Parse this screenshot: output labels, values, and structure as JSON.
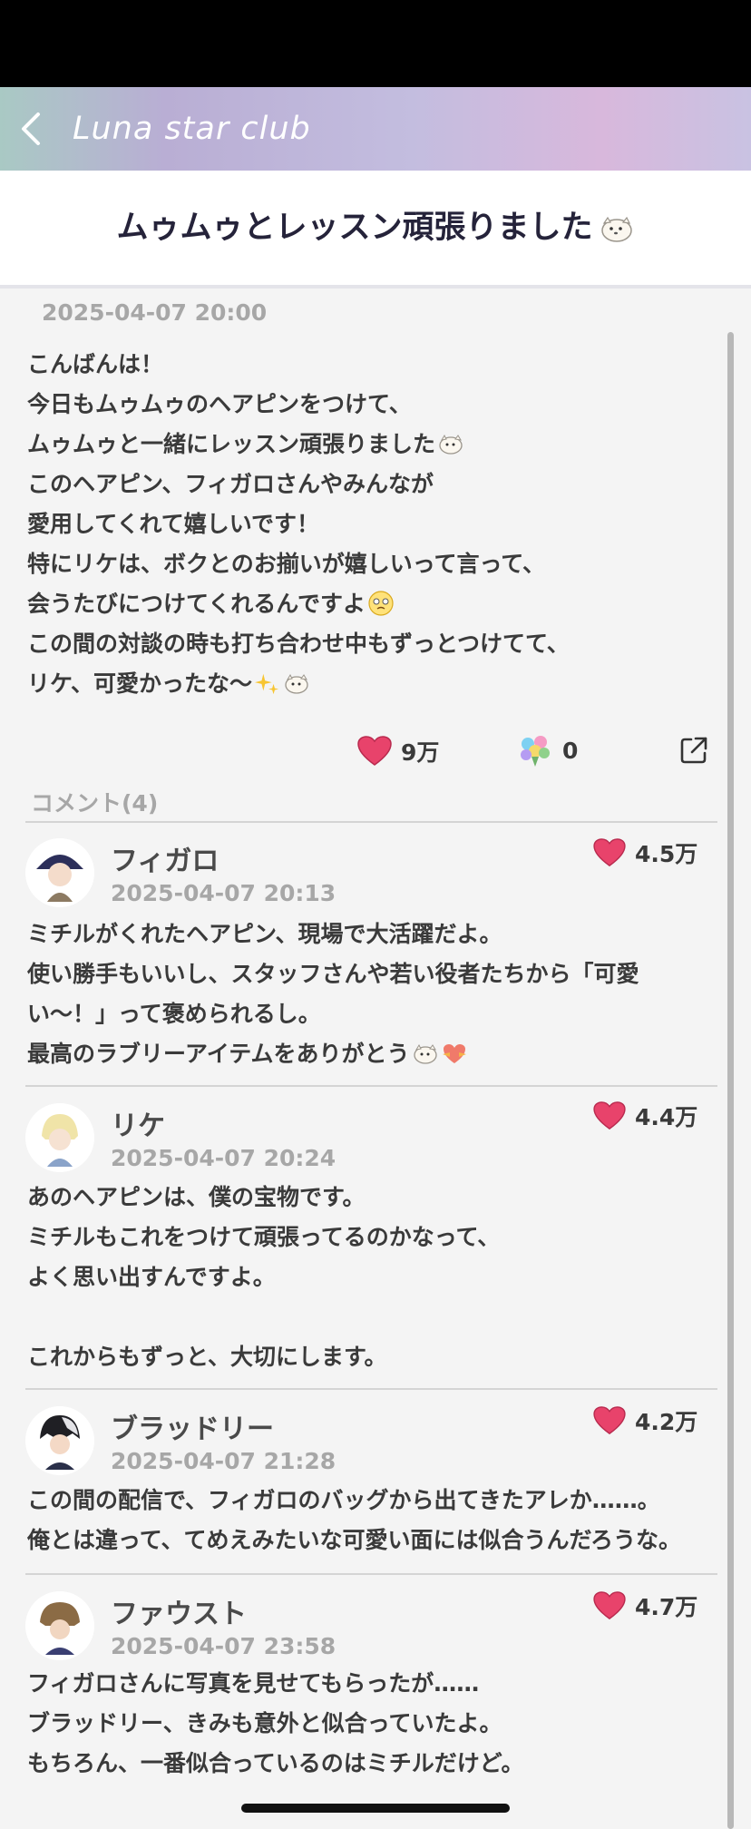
{
  "app": {
    "title": "Luna star club",
    "accent_color": "#e8436b"
  },
  "post": {
    "title": "ムゥムゥとレッスン頑張りました",
    "date": "2025-04-07 20:00",
    "lines": [
      "こんばんは！",
      "今日もムゥムゥのヘアピンをつけて、",
      "ムゥムゥと一緒にレッスン頑張りました",
      "このヘアピン、フィガロさんやみんなが",
      "愛用してくれて嬉しいです！",
      "特にリケは、ボクとのお揃いが嬉しいって言って、",
      "会うたびにつけてくれるんですよ",
      "この間の対談の時も打ち合わせ中もずっとつけてて、",
      "リケ、可愛かったな〜"
    ],
    "likes": "9万",
    "bouquets": "0",
    "icons": {
      "like": "heart-icon",
      "bouquet": "flower-bouquet-icon",
      "share": "share-icon"
    }
  },
  "comments_header": "コメント(4)",
  "comments": [
    {
      "name": "フィガロ",
      "date": "2025-04-07 20:13",
      "likes": "4.5万",
      "lines": [
        "ミチルがくれたヘアピン、現場で大活躍だよ。",
        "使い勝手もいいし、スタッフさんや若い役者たちから「可愛",
        "い〜！」って褒められるし。",
        "最高のラブリーアイテムをありがとう"
      ]
    },
    {
      "name": "リケ",
      "date": "2025-04-07 20:24",
      "likes": "4.4万",
      "lines": [
        "あのヘアピンは、僕の宝物です。",
        "ミチルもこれをつけて頑張ってるのかなって、",
        "よく思い出すんですよ。",
        "",
        "これからもずっと、大切にします。"
      ]
    },
    {
      "name": "ブラッドリー",
      "date": "2025-04-07 21:28",
      "likes": "4.2万",
      "lines": [
        "この間の配信で、フィガロのバッグから出てきたアレか……。",
        "俺とは違って、てめえみたいな可愛い面には似合うんだろうな。"
      ]
    },
    {
      "name": "ファウスト",
      "date": "2025-04-07 23:58",
      "likes": "4.7万",
      "lines": [
        "フィガロさんに写真を見せてもらったが……",
        "ブラッドリー、きみも意外と似合っていたよ。",
        "もちろん、一番似合っているのはミチルだけど。"
      ]
    }
  ]
}
